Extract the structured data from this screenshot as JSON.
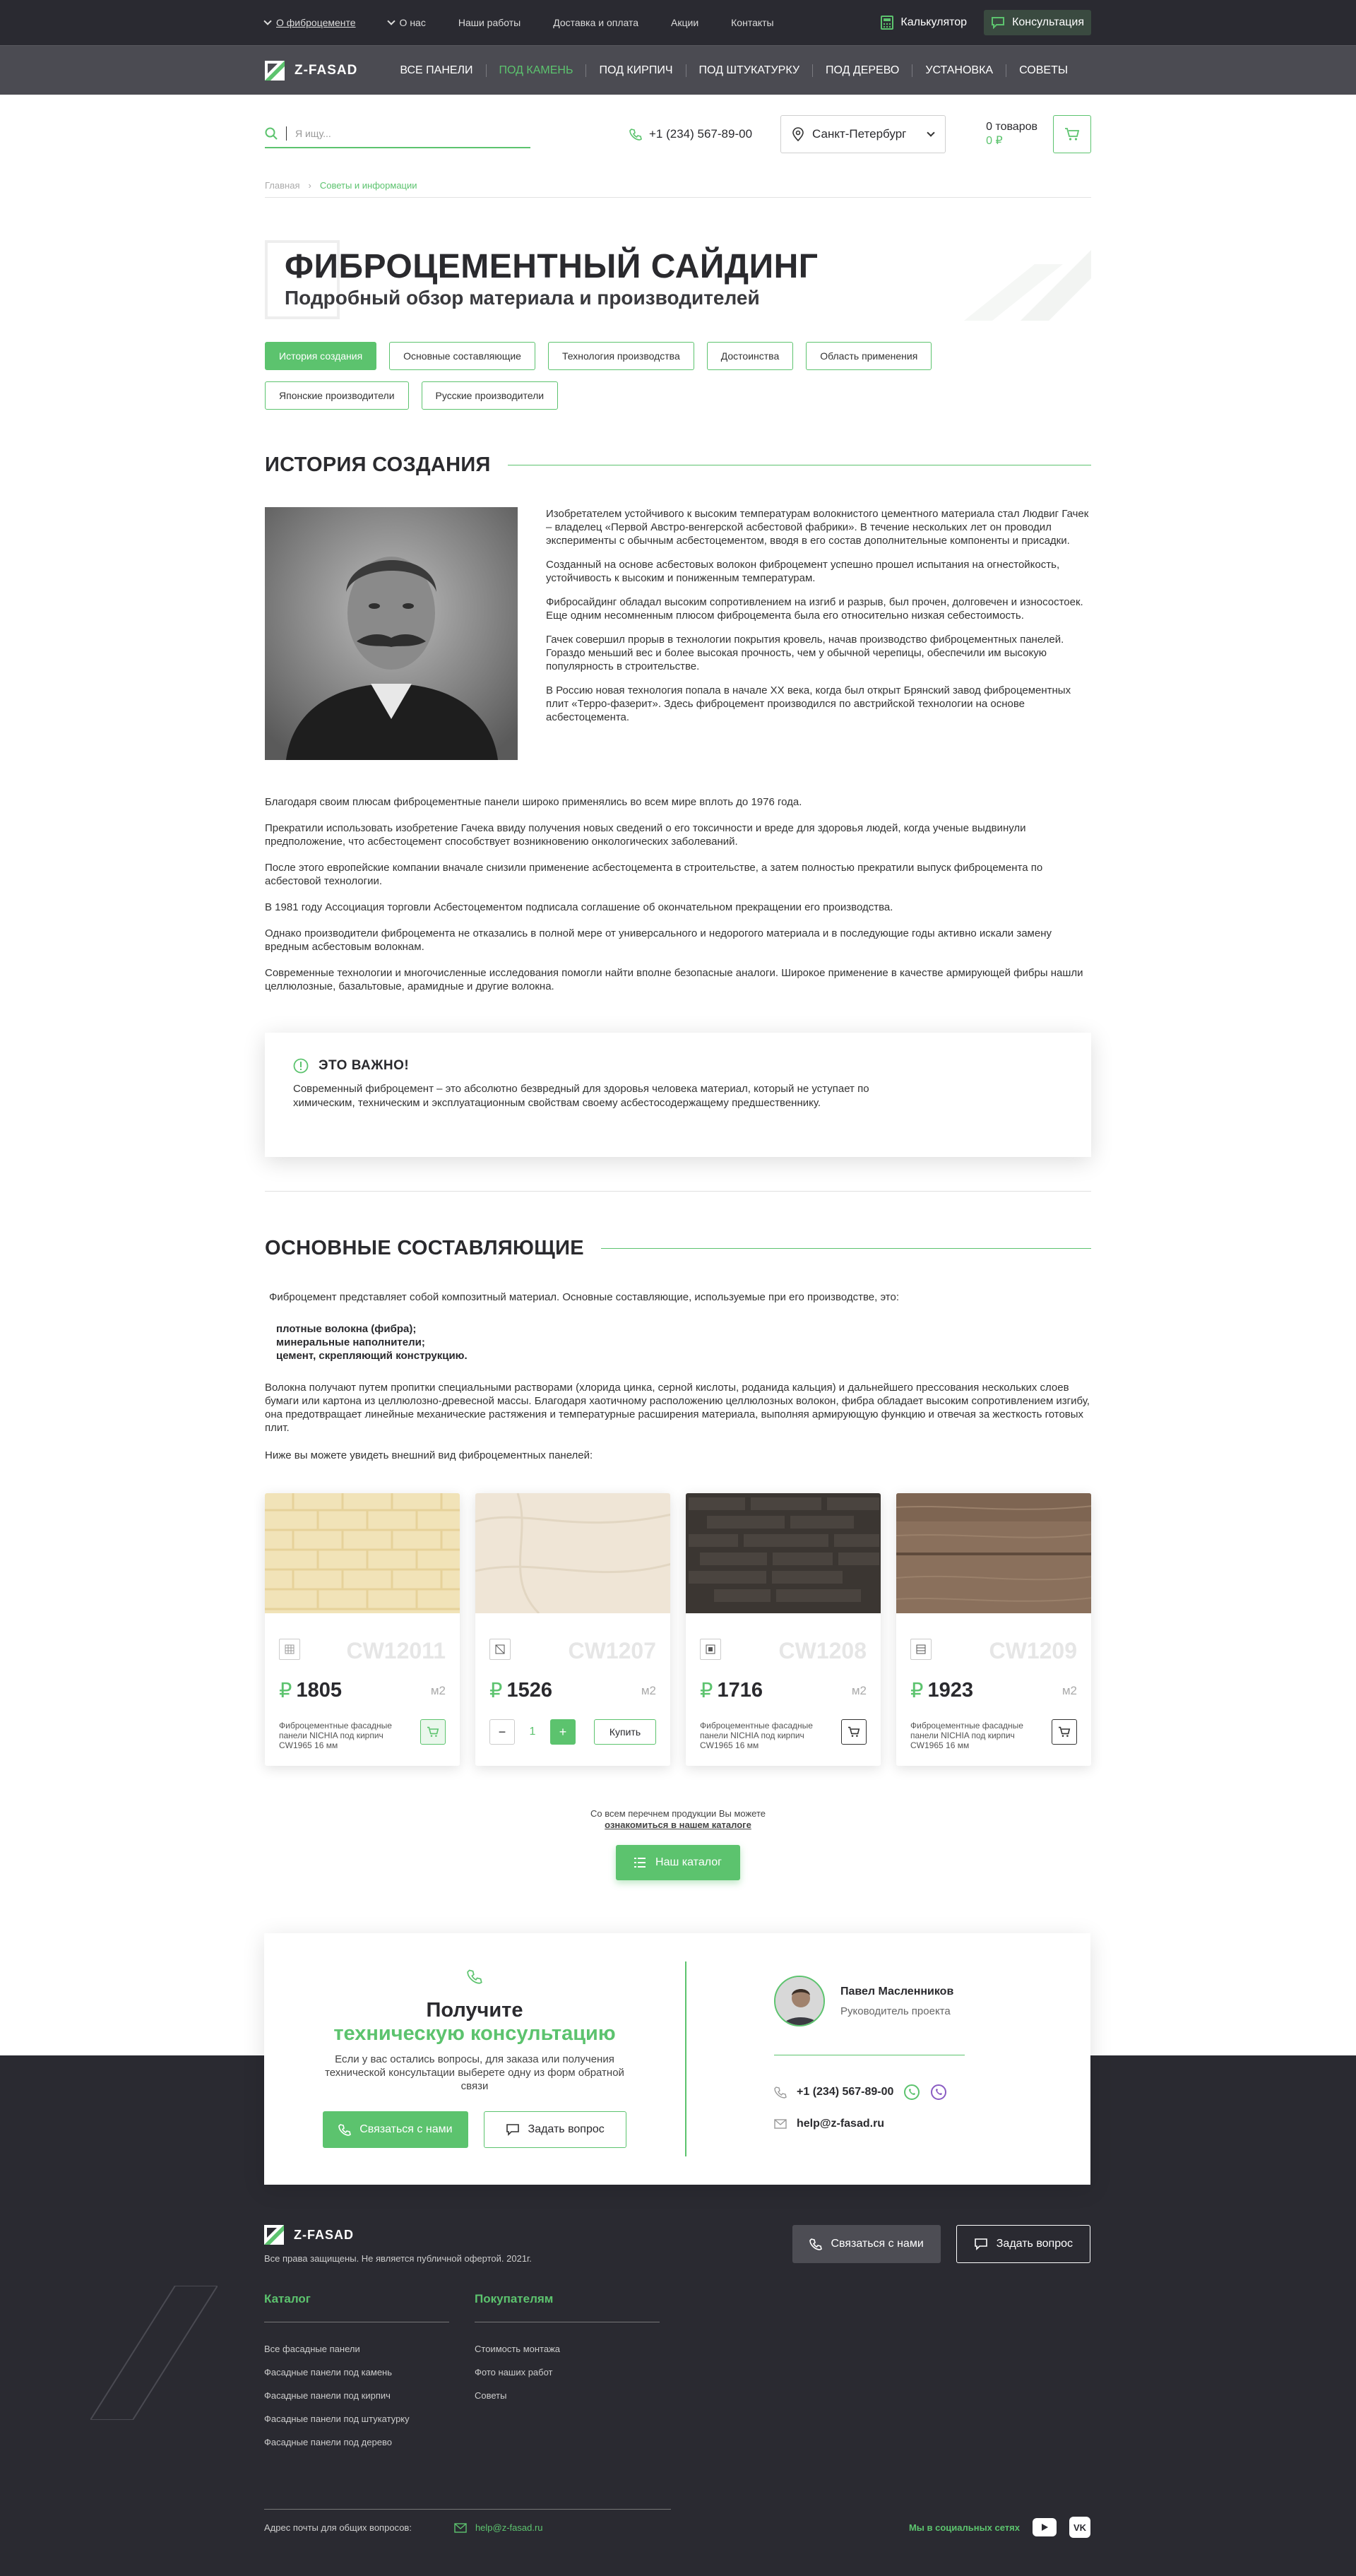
{
  "topbar": {
    "items": [
      "О фиброцементе",
      "О нас",
      "Наши работы",
      "Доставка и оплата",
      "Акции",
      "Контакты"
    ],
    "calculator": "Калькулятор",
    "consultation": "Консультация"
  },
  "nav": {
    "logo": "Z-FASAD",
    "items": [
      "ВСЕ ПАНЕЛИ",
      "ПОД КАМЕНЬ",
      "ПОД КИРПИЧ",
      "ПОД ШТУКАТУРКУ",
      "ПОД ДЕРЕВО",
      "УСТАНОВКА",
      "СОВЕТЫ"
    ],
    "active_index": 1
  },
  "search": {
    "placeholder": "Я ищу..."
  },
  "phone": "+1 (234) 567-89-00",
  "city": "Санкт-Петербург",
  "cart": {
    "count": "0 товаров",
    "sum": "0 ₽"
  },
  "breadcrumb": {
    "home": "Главная",
    "current": "Советы и информации"
  },
  "hero": {
    "title": "ФИБРОЦЕМЕНТНЫЙ САЙДИНГ",
    "subtitle": "Подробный обзор материала и производителей"
  },
  "tabs": [
    "История создания",
    "Основные составляющие",
    "Технология производства",
    "Достоинства",
    "Область применения",
    "Японские производители",
    "Русские производители"
  ],
  "history": {
    "title": "ИСТОРИЯ СОЗДАНИЯ",
    "side_paragraphs": [
      "Изобретателем устойчивого к высоким температурам волокнистого цементного материала стал Людвиг Гачек – владелец «Первой Австро-венгерской асбестовой фабрики». В течение нескольких лет он проводил эксперименты с обычным асбестоцементом, вводя в его состав дополнительные компоненты и присадки.",
      "Созданный на основе асбестовых волокон фиброцемент успешно прошел испытания на огнестойкость, устойчивость к высоким и пониженным температурам.",
      "Фибросайдинг обладал высоким сопротивлением на изгиб и разрыв, был прочен, долговечен и износостоек. Еще одним несомненным плюсом фиброцемента была его относительно низкая себестоимость.",
      "Гачек совершил прорыв в технологии покрытия кровель, начав производство фиброцементных панелей. Гораздо меньший вес и более высокая прочность, чем у обычной черепицы, обеспечили им высокую популярность в строительстве.",
      "В Россию новая технология попала в начале XX века, когда был открыт Брянский завод фиброцементных плит «Терро-фазерит». Здесь фиброцемент производился по австрийской технологии на основе асбестоцемента."
    ],
    "paragraphs": [
      "Благодаря своим плюсам фиброцементные панели широко применялись во всем мире вплоть до 1976 года.",
      "Прекратили использовать изобретение Гачека ввиду получения новых сведений о его токсичности и вреде для здоровья людей, когда ученые выдвинули предположение, что асбестоцемент способствует возникновению онкологических заболеваний.",
      "После этого европейские компании вначале снизили применение асбестоцемента в строительстве, а затем полностью прекратили выпуск фиброцемента по асбестовой технологии.",
      "В 1981 году Ассоциация торговли Асбестоцементом подписала соглашение об окончательном прекращении его производства.",
      "Однако производители фиброцемента не отказались в полной мере от универсального и недорогого материала и в последующие годы активно искали замену вредным асбестовым волокнам.",
      "Современные технологии и многочисленные исследования помогли найти вполне безопасные аналоги. Широкое применение в качестве армирующей фибры нашли целлюлозные, базальтовые, арамидные и другие волокна."
    ]
  },
  "important": {
    "title": "ЭТО ВАЖНО!",
    "text": "Современный фиброцемент – это абсолютно безвредный для здоровья человека материал, который не уступает по химическим, техническим и эксплуатационным свойствам своему асбестосодержащему предшественнику."
  },
  "components": {
    "title": "ОСНОВНЫЕ СОСТАВЛЯЮЩИЕ",
    "intro": "Фиброцемент представляет собой композитный материал. Основные составляющие, используемые при его производстве, это:",
    "list": [
      "плотные волокна (фибра);",
      "минеральные наполнители;",
      "цемент, скрепляющий конструкцию."
    ],
    "para": "Волокна получают путем пропитки специальными растворами (хлорида цинка, серной кислоты, роданида кальция) и дальнейшего прессования нескольких слоев бумаги или картона из целлюлозно-древесной массы. Благодаря хаотичному расположению целлюлозных волокон, фибра обладает высоким сопротивлением изгибу, она предотвращает линейные механические растяжения и температурные расширения материала, выполняя армирующую функцию и отвечая за жесткость готовых плит.",
    "lead": "Ниже вы можете увидеть внешний вид фиброцементных панелей:"
  },
  "products": [
    {
      "code": "CW12011",
      "price": "1805",
      "unit": "м2",
      "desc": "Фиброцементные фасадные панели NICHIA под кирпич CW1965 16 мм",
      "mode": "cart-green"
    },
    {
      "code": "CW1207",
      "price": "1526",
      "unit": "м2",
      "desc": "",
      "mode": "stepper",
      "qty": "1",
      "buy": "Купить"
    },
    {
      "code": "CW1208",
      "price": "1716",
      "unit": "м2",
      "desc": "Фиброцементные фасадные панели NICHIA под кирпич CW1965 16 мм",
      "mode": "cart"
    },
    {
      "code": "CW1209",
      "price": "1923",
      "unit": "м2",
      "desc": "Фиброцементные фасадные панели NICHIA под кирпич CW1965 16 мм",
      "mode": "cart"
    }
  ],
  "catalog_note": {
    "line1": "Со всем перечнем продукции Вы можете",
    "link": "ознакомиться в нашем каталоге",
    "button": "Наш каталог"
  },
  "consult": {
    "get": "Получите",
    "highlight": "техническую консультацию",
    "text": "Если у вас остались вопросы, для заказа или получения технической консультации выберете одну из форм обратной связи",
    "call": "Связаться с нами",
    "ask": "Задать вопрос",
    "manager_name": "Павел Масленников",
    "manager_role": "Руководитель проекта",
    "phone": "+1 (234) 567-89-00",
    "email": "help@z-fasad.ru"
  },
  "footer": {
    "logo": "Z-FASAD",
    "rights": "Все права защищены. Не является публичной офертой. 2021г.",
    "call": "Связаться с нами",
    "ask": "Задать вопрос",
    "catalog_title": "Каталог",
    "catalog": [
      "Все фасадные панели",
      "Фасадные панели под камень",
      "Фасадные панели под кирпич",
      "Фасадные панели под штукатурку",
      "Фасадные панели под дерево"
    ],
    "buyers_title": "Покупателям",
    "buyers": [
      "Стоимость монтажа",
      "Фото наших работ",
      "Советы"
    ],
    "mail_label": "Адрес почты для общих вопросов:",
    "mail": "help@z-fasad.ru",
    "social": "Мы в социальных сетях",
    "vk": "VK"
  },
  "colors": {
    "accent": "#5cc36e",
    "dark": "#2a2a31",
    "nav": "#4b4b52"
  }
}
